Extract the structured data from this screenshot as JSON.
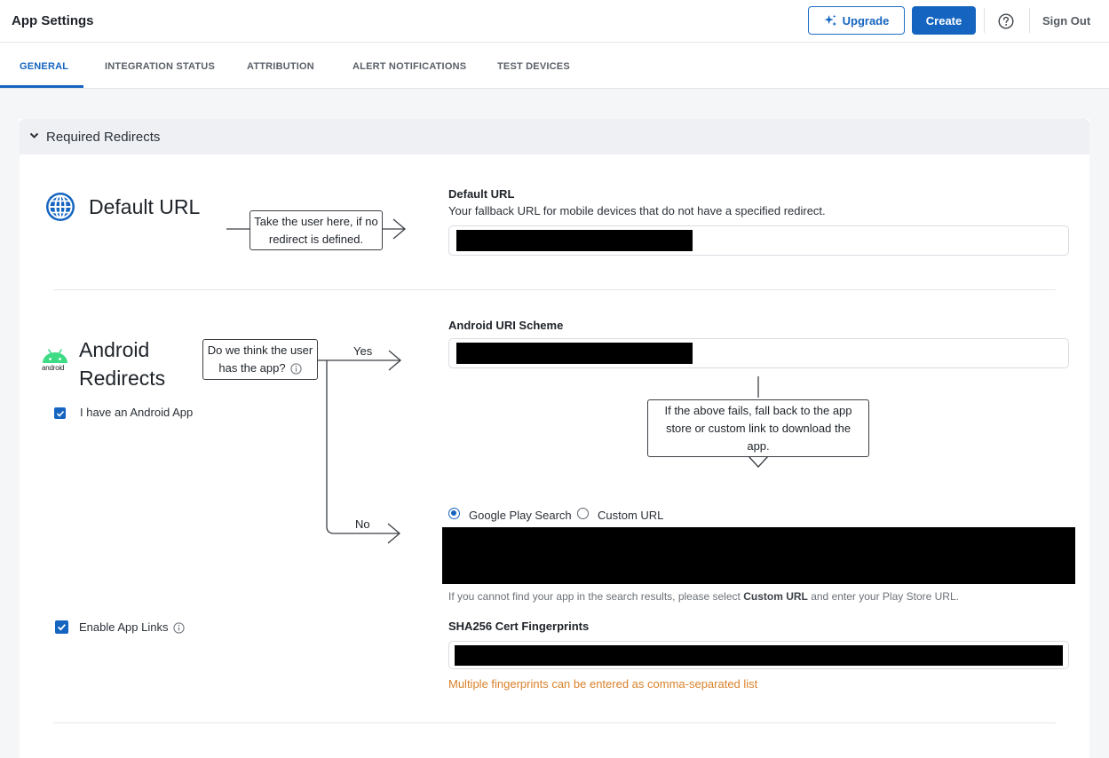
{
  "header": {
    "title": "App Settings",
    "upgrade_label": "Upgrade",
    "create_label": "Create",
    "signout_label": "Sign Out"
  },
  "tabs": [
    "GENERAL",
    "INTEGRATION STATUS",
    "ATTRIBUTION",
    "ALERT NOTIFICATIONS",
    "TEST DEVICES"
  ],
  "panel": {
    "title": "Required Redirects"
  },
  "default_url": {
    "heading": "Default URL",
    "callout": [
      "Take the user here, if no",
      "redirect is defined."
    ],
    "field_label": "Default URL",
    "field_desc": "Your fallback URL for mobile devices that do not have a specified redirect."
  },
  "android": {
    "heading_line1": "Android",
    "heading_line2": "Redirects",
    "logo_text": "android",
    "has_app_label": "I have an Android App",
    "question": [
      "Do we think the user",
      "has the app?"
    ],
    "yes_label": "Yes",
    "no_label": "No",
    "uri_label": "Android URI Scheme",
    "fallback_callout": [
      "If the above fails, fall back to the app",
      "store or custom link to download the",
      "app."
    ],
    "radio_google": "Google Play Search",
    "radio_custom": "Custom URL",
    "hint_prefix": "If you cannot find your app in the search results, please select ",
    "hint_bold": "Custom URL",
    "hint_suffix": " and enter your Play Store URL.",
    "app_links_label": "Enable App Links",
    "sha_label": "SHA256 Cert Fingerprints",
    "sha_note": "Multiple fingerprints can be entered as comma-separated list"
  },
  "colors": {
    "primary": "#1565c0",
    "android_green": "#3ddc84",
    "warning": "#d9822b"
  }
}
